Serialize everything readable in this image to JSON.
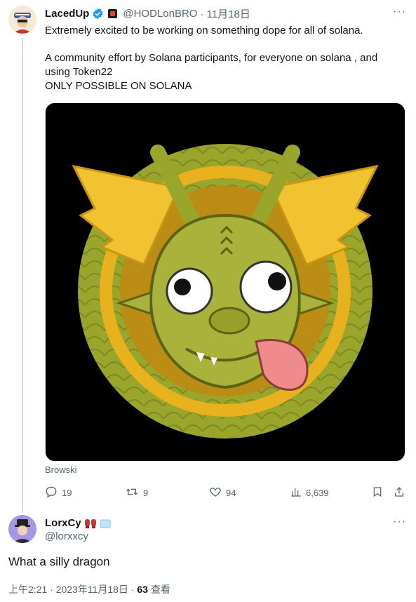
{
  "tweet": {
    "display_name": "LacedUp",
    "handle": "@HODLonBRO",
    "date": "· 11月18日",
    "text_line1": "Extremely excited to be working on something dope for all of solana.",
    "text_rest": "A community effort by Solana participants, for everyone on solana , and using Token22\nONLY POSSIBLE ON SOLANA",
    "media_caption": "Browski",
    "actions": {
      "replies": "19",
      "retweets": "9",
      "likes": "94",
      "views": "6,639"
    }
  },
  "reply": {
    "display_name": "LorxCy",
    "handle": "@lorxxcy",
    "text": "What a silly dragon",
    "meta_time": "上午2:21 · 2023年11月18日 · ",
    "meta_views_count": "63",
    "meta_views_label": " 查看"
  },
  "colors": {
    "verified": "#1d9bf0",
    "muted": "#536471",
    "dragon": "#9aa52c",
    "gold": "#e8b21e"
  },
  "icons": [
    "verified-badge-icon",
    "flag-icon",
    "more-icon",
    "reply-icon",
    "retweet-icon",
    "like-icon",
    "views-icon",
    "bookmark-icon",
    "share-icon",
    "gloves-icon",
    "ice-icon"
  ]
}
